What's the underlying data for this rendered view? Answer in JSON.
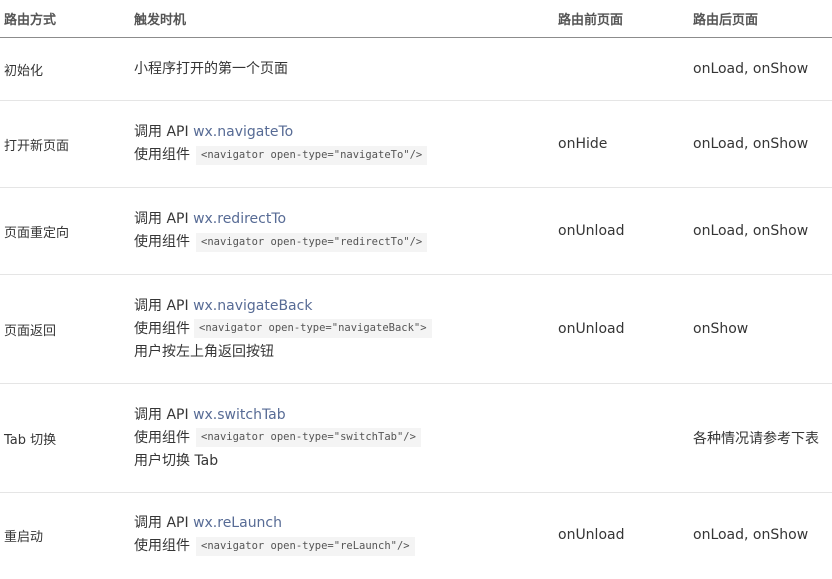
{
  "headers": [
    "路由方式",
    "触发时机",
    "路由前页面",
    "路由后页面"
  ],
  "rows": [
    {
      "method": "初始化",
      "trigger": [
        {
          "text": "小程序打开的第一个页面"
        }
      ],
      "before": "",
      "after": "onLoad, onShow"
    },
    {
      "method": "打开新页面",
      "trigger": [
        {
          "prefix": "调用 API ",
          "link": "wx.navigateTo"
        },
        {
          "prefix": "使用组件",
          "code": "<navigator open-type=\"navigateTo\"/>"
        }
      ],
      "before": "onHide",
      "after": "onLoad, onShow"
    },
    {
      "method": "页面重定向",
      "trigger": [
        {
          "prefix": "调用 API ",
          "link": "wx.redirectTo"
        },
        {
          "prefix": "使用组件",
          "code": "<navigator open-type=\"redirectTo\"/>"
        }
      ],
      "before": "onUnload",
      "after": "onLoad, onShow"
    },
    {
      "method": "页面返回",
      "trigger": [
        {
          "prefix": "调用 API ",
          "link": "wx.navigateBack"
        },
        {
          "prefix": "使用组件",
          "code": "<navigator open-type=\"navigateBack\">"
        },
        {
          "text": "用户按左上角返回按钮"
        }
      ],
      "before": "onUnload",
      "after": "onShow"
    },
    {
      "method": "Tab 切换",
      "trigger": [
        {
          "prefix": "调用 API ",
          "link": "wx.switchTab"
        },
        {
          "prefix": "使用组件",
          "code": "<navigator open-type=\"switchTab\"/>"
        },
        {
          "text": "用户切换 Tab"
        }
      ],
      "before": "",
      "after": "各种情况请参考下表"
    },
    {
      "method": "重启动",
      "trigger": [
        {
          "prefix": "调用 API ",
          "link": "wx.reLaunch"
        },
        {
          "prefix": "使用组件",
          "code": "<navigator open-type=\"reLaunch\"/>"
        }
      ],
      "before": "onUnload",
      "after": "onLoad, onShow"
    }
  ]
}
